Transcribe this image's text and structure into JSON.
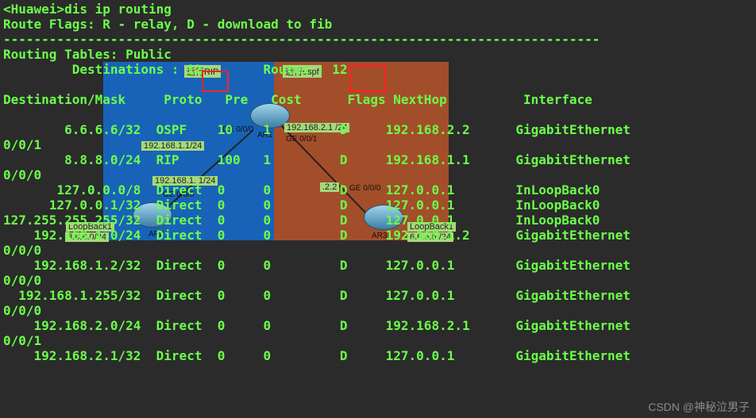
{
  "prompt_line": "<Huawei>dis ip routing",
  "flags_line": "Route Flags: R - relay, D - download to fib",
  "dash_line": "------------------------------------------------------------------------------",
  "tables_line": "Routing Tables: Public",
  "dest_label": "Destinations",
  "routes_label": "Routes",
  "dest_count": "12",
  "routes_count": "12",
  "columns": {
    "dst": "Destination/Mask",
    "proto": "Proto",
    "pre": "Pre",
    "cost": "Cost",
    "flags": "Flags",
    "nh": "NextHop",
    "ifc": "Interface"
  },
  "rows": [
    {
      "dst": "6.6.6.6/32",
      "proto": "OSPF",
      "pre": "10",
      "cost": "1",
      "flags": "D",
      "nh": "192.168.2.2",
      "ifc": "GigabitEthernet",
      "wrap": "0/0/1"
    },
    {
      "dst": "8.8.8.0/24",
      "proto": "RIP",
      "pre": "100",
      "cost": "1",
      "flags": "D",
      "nh": "192.168.1.1",
      "ifc": "GigabitEthernet",
      "wrap": "0/0/0"
    },
    {
      "dst": "127.0.0.0/8",
      "proto": "Direct",
      "pre": "0",
      "cost": "0",
      "flags": "D",
      "nh": "127.0.0.1",
      "ifc": "InLoopBack0",
      "wrap": ""
    },
    {
      "dst": "127.0.0.1/32",
      "proto": "Direct",
      "pre": "0",
      "cost": "0",
      "flags": "D",
      "nh": "127.0.0.1",
      "ifc": "InLoopBack0",
      "wrap": ""
    },
    {
      "dst": "127.255.255.255/32",
      "proto": "Direct",
      "pre": "0",
      "cost": "0",
      "flags": "D",
      "nh": "127.0.0.1",
      "ifc": "InLoopBack0",
      "wrap": ""
    },
    {
      "dst": "192.168.1.0/24",
      "proto": "Direct",
      "pre": "0",
      "cost": "0",
      "flags": "D",
      "nh": "192.168.1.2",
      "ifc": "GigabitEthernet",
      "wrap": "0/0/0"
    },
    {
      "dst": "192.168.1.2/32",
      "proto": "Direct",
      "pre": "0",
      "cost": "0",
      "flags": "D",
      "nh": "127.0.0.1",
      "ifc": "GigabitEthernet",
      "wrap": "0/0/0"
    },
    {
      "dst": "192.168.1.255/32",
      "proto": "Direct",
      "pre": "0",
      "cost": "0",
      "flags": "D",
      "nh": "127.0.0.1",
      "ifc": "GigabitEthernet",
      "wrap": "0/0/0"
    },
    {
      "dst": "192.168.2.0/24",
      "proto": "Direct",
      "pre": "0",
      "cost": "0",
      "flags": "D",
      "nh": "192.168.2.1",
      "ifc": "GigabitEthernet",
      "wrap": "0/0/1"
    },
    {
      "dst": "192.168.2.1/32",
      "proto": "Direct",
      "pre": "0",
      "cost": "0",
      "flags": "D",
      "nh": "127.0.0.1",
      "ifc": "GigabitEthernet",
      "wrap": ""
    }
  ],
  "diagram": {
    "rip_tag": "运行RIP",
    "ospf_tag": "运行ospf",
    "ar1": "AR1",
    "ar2": "AR2",
    "ar3": "AR3",
    "loopback1": "LoopBack1",
    "loopback2": "LoopBack1",
    "ge00": "GE 0/0/0",
    "ge01": "GE 0/0/1",
    "ip1": "192.168.1.1/24",
    "ip2": "192.168.2.1 /24",
    "ip3": "192.168.1.    1/24",
    "ip4": ".2.2",
    "subnet1": "8.8.8.0/24",
    "subnet2": "6.6.6.6 /24"
  },
  "watermark": "CSDN @神秘泣男子"
}
